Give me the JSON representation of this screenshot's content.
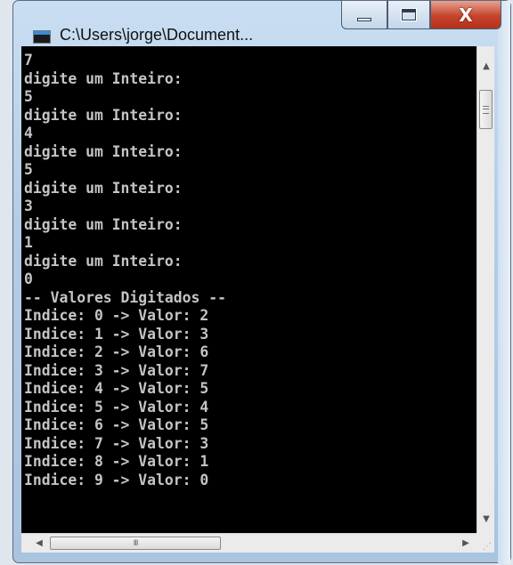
{
  "window": {
    "title": "C:\\Users\\jorge\\Document..."
  },
  "caption_buttons": {
    "minimize_icon": "minimize-icon",
    "maximize_icon": "maximize-icon",
    "close_icon": "close-icon",
    "close_glyph": "X",
    "close_color": "#c6442c"
  },
  "console": {
    "background": "#000000",
    "text_color": "#c4c4c4",
    "lines": [
      "7",
      "digite um Inteiro:",
      "5",
      "digite um Inteiro:",
      "4",
      "digite um Inteiro:",
      "5",
      "digite um Inteiro:",
      "3",
      "digite um Inteiro:",
      "1",
      "digite um Inteiro:",
      "0",
      "-- Valores Digitados --",
      "Indice: 0 -> Valor: 2",
      "Indice: 1 -> Valor: 3",
      "Indice: 2 -> Valor: 6",
      "Indice: 3 -> Valor: 7",
      "Indice: 4 -> Valor: 5",
      "Indice: 5 -> Valor: 4",
      "Indice: 6 -> Valor: 5",
      "Indice: 7 -> Valor: 3",
      "Indice: 8 -> Valor: 1",
      "Indice: 9 -> Valor: 0"
    ]
  },
  "scrollbars": {
    "up_arrow": "▲",
    "down_arrow": "▼",
    "left_arrow": "◀",
    "right_arrow": "▶",
    "h_thumb_grip": "III"
  }
}
